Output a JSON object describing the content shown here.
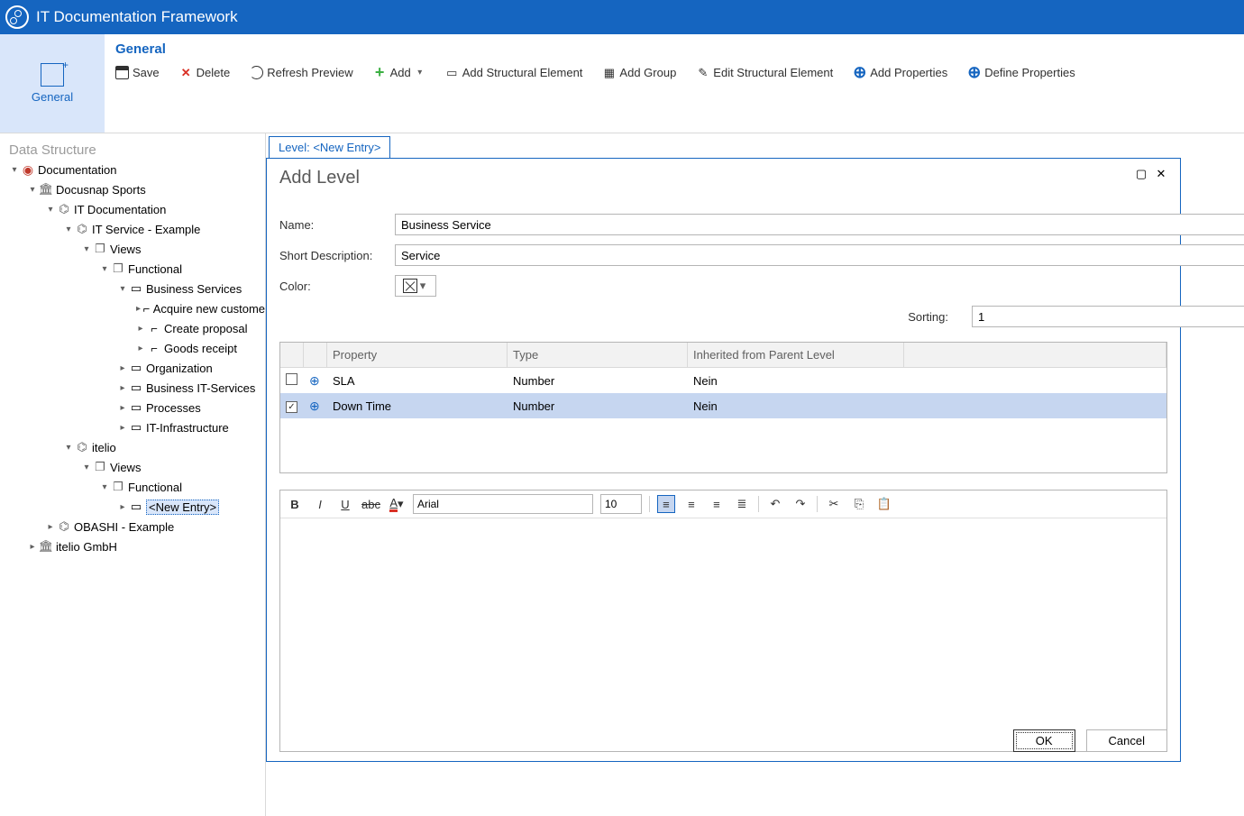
{
  "title": "IT Documentation Framework",
  "vtab": {
    "label": "General"
  },
  "ribbon_head": "General",
  "tools": {
    "save": "Save",
    "delete": "Delete",
    "refresh": "Refresh Preview",
    "add": "Add",
    "add_struct": "Add Structural Element",
    "add_group": "Add Group",
    "edit_struct": "Edit Structural Element",
    "add_props": "Add Properties",
    "define_props": "Define Properties"
  },
  "sidebar_head": "Data Structure",
  "tree": {
    "root": "Documentation",
    "n1": "Docusnap Sports",
    "n2": "IT Documentation",
    "n3": "IT Service - Example",
    "views": "Views",
    "fn": "Functional",
    "bs": "Business Services",
    "bs1": "Acquire new custome",
    "bs2": "Create proposal",
    "bs3": "Goods receipt",
    "org": "Organization",
    "bits": "Business IT-Services",
    "proc": "Processes",
    "itinf": "IT-Infrastructure",
    "itelio": "itelio",
    "newentry": "<New Entry>",
    "obashi": "OBASHI - Example",
    "iteliog": "itelio GmbH"
  },
  "level_tab_prefix": "Level: ",
  "level_tab_value": "<New Entry>",
  "panel_title": "Add Level",
  "form": {
    "name_lbl": "Name:",
    "name_val": "Business Service",
    "desc_lbl": "Short Description:",
    "desc_val": "Service",
    "color_lbl": "Color:",
    "sort_lbl": "Sorting:",
    "sort_val": "1"
  },
  "grid": {
    "col_prop": "Property",
    "col_type": "Type",
    "col_inh": "Inherited from Parent Level",
    "rows": [
      {
        "checked": false,
        "prop": "SLA",
        "type": "Number",
        "inh": "Nein"
      },
      {
        "checked": true,
        "prop": "Down Time",
        "type": "Number",
        "inh": "Nein"
      }
    ]
  },
  "editor": {
    "font": "Arial",
    "size": "10"
  },
  "buttons": {
    "ok": "OK",
    "cancel": "Cancel"
  }
}
